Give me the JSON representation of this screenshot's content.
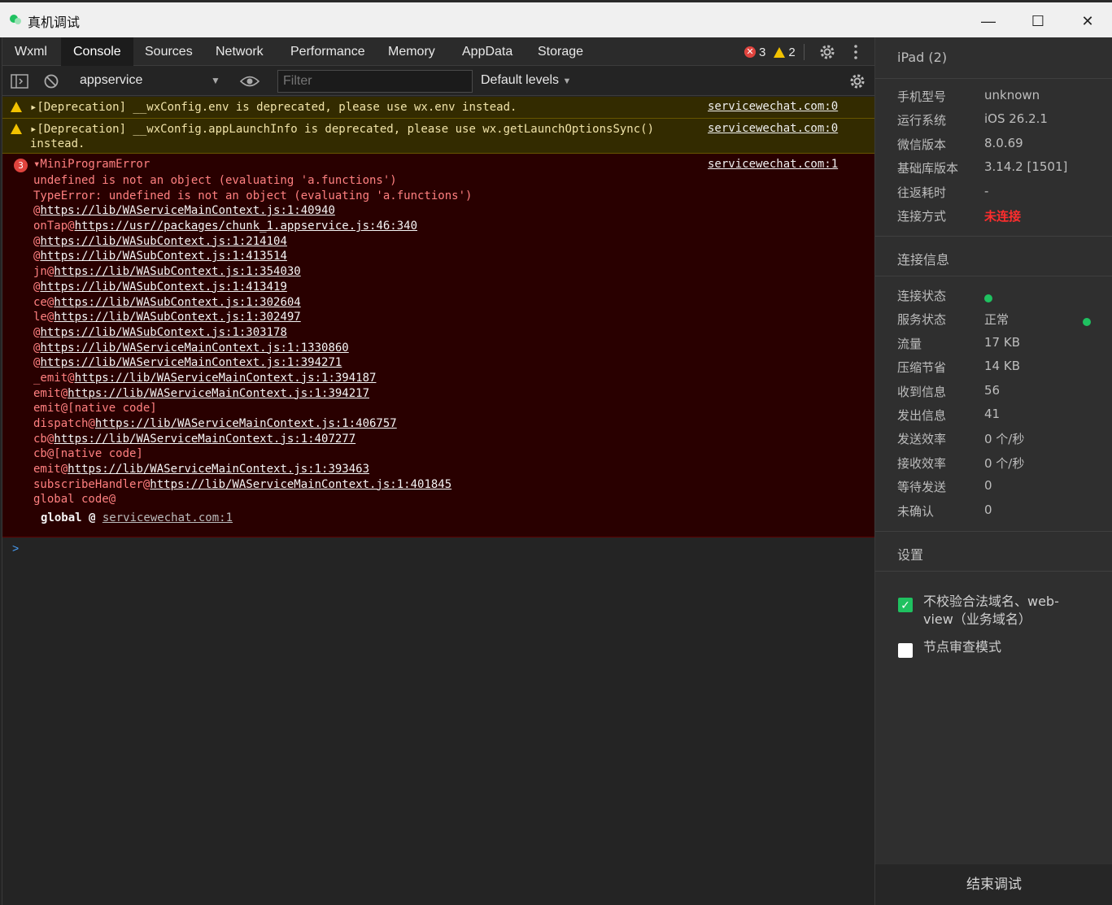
{
  "window": {
    "title": "真机调试",
    "controls": {
      "minimize": "—",
      "maximize": "☐",
      "close": "✕"
    }
  },
  "tabs": [
    "Wxml",
    "Console",
    "Sources",
    "Network",
    "Performance",
    "Memory",
    "AppData",
    "Storage"
  ],
  "active_tab": "Console",
  "counters": {
    "errors": "3",
    "warnings": "2"
  },
  "toolbar": {
    "context": "appservice",
    "filter_placeholder": "Filter",
    "levels": "Default levels"
  },
  "console": {
    "warnings": [
      {
        "text": "▸[Deprecation] __wxConfig.env is deprecated, please use wx.env instead.",
        "source": "servicewechat.com:0"
      },
      {
        "text": "▸[Deprecation] __wxConfig.appLaunchInfo is deprecated, please use wx.getLaunchOptionsSync()\ninstead.",
        "source": "servicewechat.com:0"
      }
    ],
    "error": {
      "count": "3",
      "title": "▾MiniProgramError",
      "source": "servicewechat.com:1",
      "message1": "undefined is not an object (evaluating 'a.functions')",
      "message2": "TypeError: undefined is not an object (evaluating 'a.functions')",
      "stack": [
        {
          "prefix": "@",
          "link": "https://lib/WAServiceMainContext.js:1:40940"
        },
        {
          "prefix": "onTap@",
          "link": "https://usr//packages/chunk_1.appservice.js:46:340"
        },
        {
          "prefix": "@",
          "link": "https://lib/WASubContext.js:1:214104"
        },
        {
          "prefix": "@",
          "link": "https://lib/WASubContext.js:1:413514"
        },
        {
          "prefix": "jn@",
          "link": "https://lib/WASubContext.js:1:354030"
        },
        {
          "prefix": "@",
          "link": "https://lib/WASubContext.js:1:413419"
        },
        {
          "prefix": "ce@",
          "link": "https://lib/WASubContext.js:1:302604"
        },
        {
          "prefix": "le@",
          "link": "https://lib/WASubContext.js:1:302497"
        },
        {
          "prefix": "@",
          "link": "https://lib/WASubContext.js:1:303178"
        },
        {
          "prefix": "@",
          "link": "https://lib/WAServiceMainContext.js:1:1330860"
        },
        {
          "prefix": "@",
          "link": "https://lib/WAServiceMainContext.js:1:394271"
        },
        {
          "prefix": "_emit@",
          "link": "https://lib/WAServiceMainContext.js:1:394187"
        },
        {
          "prefix": "emit@",
          "link": "https://lib/WAServiceMainContext.js:1:394217"
        },
        {
          "prefix": "emit@[native code]",
          "link": ""
        },
        {
          "prefix": "dispatch@",
          "link": "https://lib/WAServiceMainContext.js:1:406757"
        },
        {
          "prefix": "cb@",
          "link": "https://lib/WAServiceMainContext.js:1:407277"
        },
        {
          "prefix": "cb@[native code]",
          "link": ""
        },
        {
          "prefix": "emit@",
          "link": "https://lib/WAServiceMainContext.js:1:393463"
        },
        {
          "prefix": "subscribeHandler@",
          "link": "https://lib/WAServiceMainContext.js:1:401845"
        },
        {
          "prefix": "global code@",
          "link": ""
        }
      ],
      "global_label": "global @ ",
      "global_link": "servicewechat.com:1"
    },
    "prompt": ">"
  },
  "device": {
    "name": "iPad (2)",
    "info": [
      {
        "key": "手机型号",
        "value": "unknown"
      },
      {
        "key": "运行系统",
        "value": "iOS 26.2.1"
      },
      {
        "key": "微信版本",
        "value": "8.0.69"
      },
      {
        "key": "基础库版本",
        "value": "3.14.2 [1501]"
      },
      {
        "key": "往返耗时",
        "value": "-"
      },
      {
        "key": "连接方式",
        "value": "未连接"
      }
    ]
  },
  "connection": {
    "header": "连接信息",
    "info": [
      {
        "key": "连接状态",
        "value": ""
      },
      {
        "key": "服务状态",
        "value": "正常"
      },
      {
        "key": "流量",
        "value": "17 KB"
      },
      {
        "key": "压缩节省",
        "value": "14 KB"
      },
      {
        "key": "收到信息",
        "value": "56"
      },
      {
        "key": "发出信息",
        "value": "41"
      },
      {
        "key": "发送效率",
        "value": "0 个/秒"
      },
      {
        "key": "接收效率",
        "value": "0 个/秒"
      },
      {
        "key": "等待发送",
        "value": "0"
      },
      {
        "key": "未确认",
        "value": "0"
      }
    ]
  },
  "settings": {
    "header": "设置",
    "options": [
      {
        "label": "不校验合法域名、web-view（业务域名）",
        "checked": true
      },
      {
        "label": "节点审查模式",
        "checked": false
      }
    ]
  },
  "end_button": "结束调试",
  "colors": {
    "accent_green": "#1fc160",
    "error_red": "#e0443e",
    "warning_yellow": "#f2c200"
  }
}
